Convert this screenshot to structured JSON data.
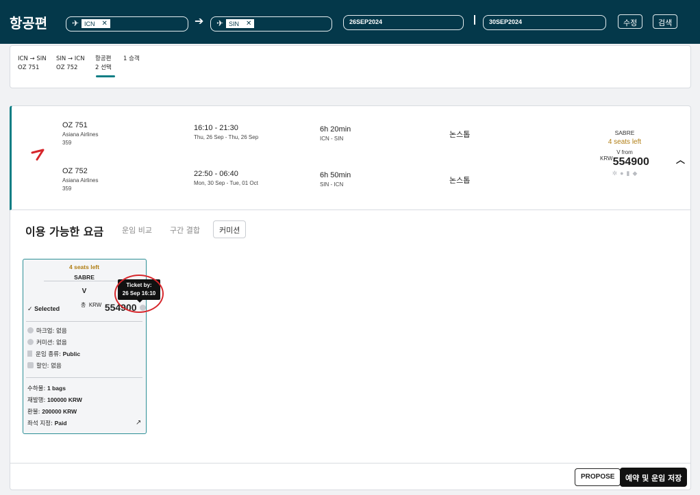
{
  "header": {
    "title": "항공편",
    "origin_tag": "ICN",
    "dest_tag": "SIN",
    "depart_date": "26SEP2024",
    "return_date": "30SEP2024",
    "edit_label": "수정",
    "search_label": "검색"
  },
  "tabs": [
    {
      "line1": "ICN → SIN",
      "line2": "OZ 751"
    },
    {
      "line1": "SIN → ICN",
      "line2": "OZ 752"
    },
    {
      "line1": "항공편",
      "line2": "2 선택"
    },
    {
      "line1": "1 승객",
      "line2": ""
    }
  ],
  "itinerary": {
    "outbound": {
      "flight_no": "OZ 751",
      "airline": "Asiana Airlines",
      "aircraft": "359",
      "time": "16:10 - 21:30",
      "date": "Thu, 26 Sep - Thu, 26 Sep",
      "duration": "6h 20min",
      "route": "ICN - SIN",
      "stops": "논스톱"
    },
    "inbound": {
      "flight_no": "OZ 752",
      "airline": "Asiana Airlines",
      "aircraft": "359",
      "time": "22:50 - 06:40",
      "date": "Mon, 30 Sep - Tue, 01 Oct",
      "duration": "6h 50min",
      "route": "SIN - ICN",
      "stops": "논스톱"
    },
    "provider": "SABRE",
    "seats_left": "4 seats left",
    "fare_class_from": "V from",
    "currency": "KRW",
    "price": "554900",
    "icons": [
      "gear-icon",
      "circle-icon",
      "bookmark-icon",
      "tag-icon"
    ]
  },
  "fares": {
    "title": "이용 가능한 요금",
    "tabs": [
      "운임 비교",
      "구간 결합",
      "커미션"
    ],
    "card": {
      "seats_left": "4 seats left",
      "provider": "SABRE",
      "fare_class": "V",
      "selected_label": "Selected",
      "total_prefix": "총",
      "currency": "KRW",
      "price": "554900",
      "markup_label": "마크업:",
      "markup_value": "없음",
      "commission_label": "커미션:",
      "commission_value": "없음",
      "fare_type_label": "운임 종류:",
      "fare_type_value": "Public",
      "discount_label": "할인:",
      "discount_value": "없음",
      "baggage_label": "수하물:",
      "baggage_value": "1 bags",
      "reissue_label": "재발행:",
      "reissue_value": "100000 KRW",
      "refund_label": "환불:",
      "refund_value": "200000 KRW",
      "seat_label": "좌석 지정:",
      "seat_value": "Paid"
    },
    "tooltip": {
      "line1": "Ticket by:",
      "line2": "26 Sep 16:10"
    }
  },
  "footer": {
    "propose_label": "PROPOSE",
    "save_label": "예약 및 운임 저장"
  },
  "colors": {
    "header_bg": "#04384a",
    "accent_teal": "#0b7d84",
    "seats_gold": "#b07d12",
    "annotation_red": "#d6262b"
  }
}
